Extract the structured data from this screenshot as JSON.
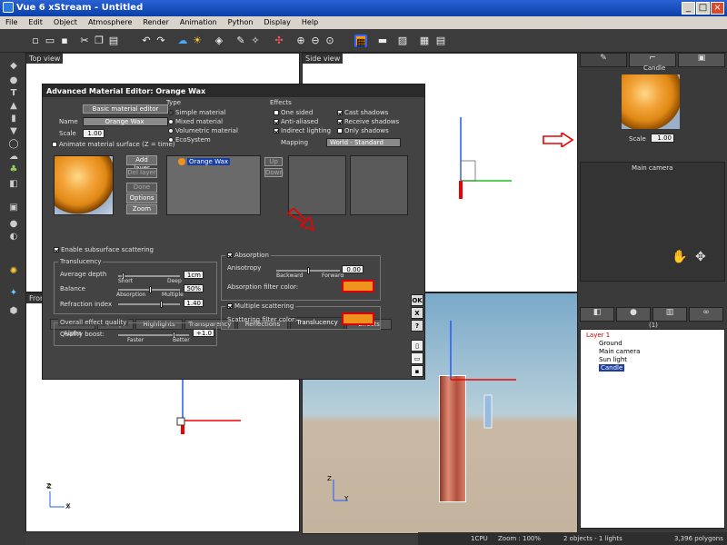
{
  "window": {
    "title": "Vue 6 xStream - Untitled",
    "min": "_",
    "max": "□",
    "close": "×"
  },
  "menu": [
    "File",
    "Edit",
    "Object",
    "Atmosphere",
    "Render",
    "Animation",
    "Python",
    "Display",
    "Help"
  ],
  "toolbar": {
    "icons": [
      "new-icon",
      "open-icon",
      "save-icon",
      "cut-icon",
      "copy-icon",
      "paste-icon",
      "undo-icon",
      "redo-icon",
      "sky-icon",
      "sun-cloud-icon",
      "object-icon",
      "wand-icon",
      "material-icon",
      "transform-icon",
      "zoom-in-icon",
      "zoom-out-icon",
      "zoom-fit-icon",
      "render-icon",
      "film-icon",
      "frame-icon",
      "grid-icon"
    ]
  },
  "viewports": {
    "top": {
      "label": "Top view"
    },
    "side": {
      "label": "Side view"
    },
    "front": {
      "label": "Front view"
    },
    "main": {
      "label": "Main camera"
    },
    "axis_z": "Z",
    "axis_y": "Y",
    "axis_x": "X"
  },
  "dialog": {
    "title": "Advanced Material Editor: Orange Wax",
    "basic_button": "Basic material editor",
    "name_label": "Name",
    "name_value": "Orange Wax",
    "scale_label": "Scale",
    "scale_value": "1.00",
    "animate_label": "Animate material surface (Z = time)",
    "type_title": "Type",
    "types": [
      "Simple material",
      "Mixed material",
      "Volumetric material",
      "EcoSystem"
    ],
    "effects_title": "Effects",
    "effects_left": [
      "One sided",
      "Anti-aliased",
      "Indirect lighting"
    ],
    "effects_right": [
      "Cast shadows",
      "Receive shadows",
      "Only shadows"
    ],
    "effects_left_checked": [
      false,
      true,
      true
    ],
    "effects_right_checked": [
      true,
      true,
      false
    ],
    "mapping_label": "Mapping",
    "mapping_value": "World - Standard",
    "layer_buttons": [
      "Add layer",
      "Del layer",
      "Done",
      "Options",
      "Zoom"
    ],
    "layer_name": "Orange Wax",
    "up": "Up",
    "down": "Down",
    "tabs": [
      "Color & Alpha",
      "Bumps",
      "Highlights",
      "Transparency",
      "Reflections",
      "Translucency",
      "Effects"
    ],
    "active_tab": "Translucency",
    "enable_sss": "Enable subsurface scattering",
    "translucency_title": "Translucency",
    "avg_depth_label": "Average depth",
    "avg_depth_value": "1cm",
    "short_label": "Short",
    "deep_label": "Deep",
    "balance_label": "Balance",
    "balance_value": "50%",
    "balance_level": 0.5,
    "absorption_label": "Absorption",
    "multiple_label": "Multiple",
    "refraction_label": "Refraction index",
    "refraction_value": "1.40",
    "absorption_title": "Absorption",
    "anisotropy_label": "Anisotropy",
    "anisotropy_value": "0.00",
    "backward_label": "Backward",
    "forward_label": "Forward",
    "abs_filter_label": "Absorption filter color:",
    "mult_title": "Multiple scattering",
    "scat_filter_label": "Scattering filter color:",
    "filter_color": "#f0921e",
    "overall_title": "Overall effect quality",
    "quality_label": "Quality boost:",
    "quality_value": "+1.0",
    "faster_label": "Faster",
    "better_label": "Better",
    "side_buttons": [
      "OK",
      "X",
      "?"
    ]
  },
  "right_panel": {
    "object_name": "Candle",
    "scale_label": "Scale",
    "scale_value": "1.00",
    "camera_title": "Main camera",
    "layer_count": "(1)",
    "tree": [
      "Layer 1",
      "Ground",
      "Main camera",
      "Sun light",
      "Candle"
    ]
  },
  "status": {
    "cpu": "1CPU",
    "zoom": "Zoom : 100%",
    "objects": "2 objects - 1 lights",
    "polygons": "3,396 polygons"
  },
  "colors": {
    "accent_red": "#e00000",
    "orange": "#f0921e",
    "title_blue": "#0a3fa8"
  }
}
